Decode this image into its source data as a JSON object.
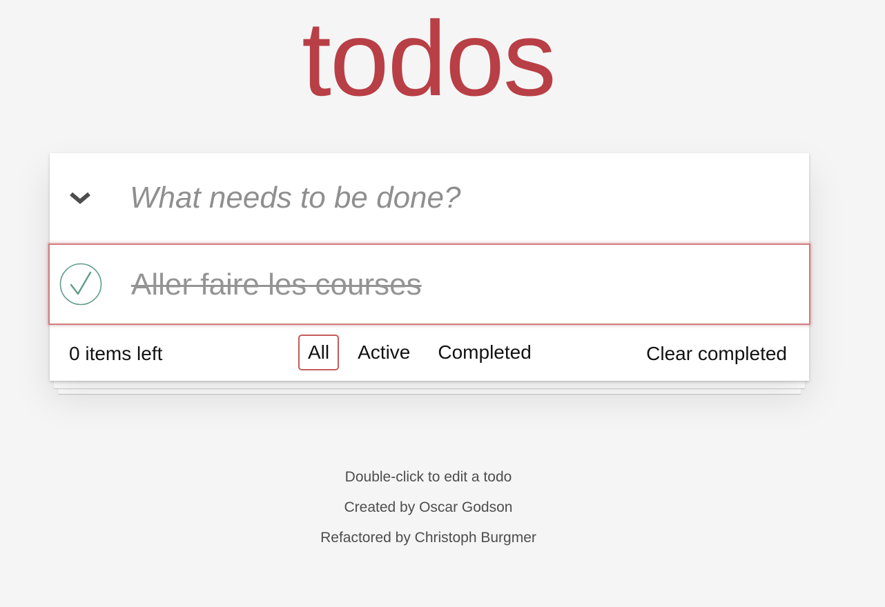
{
  "app": {
    "title": "todos"
  },
  "header": {
    "toggle_all_icon": "chevron-down-icon",
    "new_todo_placeholder": "What needs to be done?"
  },
  "todos": [
    {
      "label": "Aller faire les courses",
      "completed": true,
      "check_icon": "checkmark-circle-icon"
    }
  ],
  "footer": {
    "count_text": "0 items left",
    "filters": [
      {
        "label": "All",
        "selected": true
      },
      {
        "label": "Active",
        "selected": false
      },
      {
        "label": "Completed",
        "selected": false
      }
    ],
    "clear_completed": "Clear completed"
  },
  "info": {
    "line1": "Double-click to edit a todo",
    "line2": "Created by Oscar Godson",
    "line3": "Refactored by Christoph Burgmer"
  },
  "colors": {
    "title": "#b83f45",
    "focus_border": "#cf7d7d",
    "selected_filter_border": "#c45b5b",
    "check_green": "#5dc2af",
    "background": "#f5f5f5"
  }
}
